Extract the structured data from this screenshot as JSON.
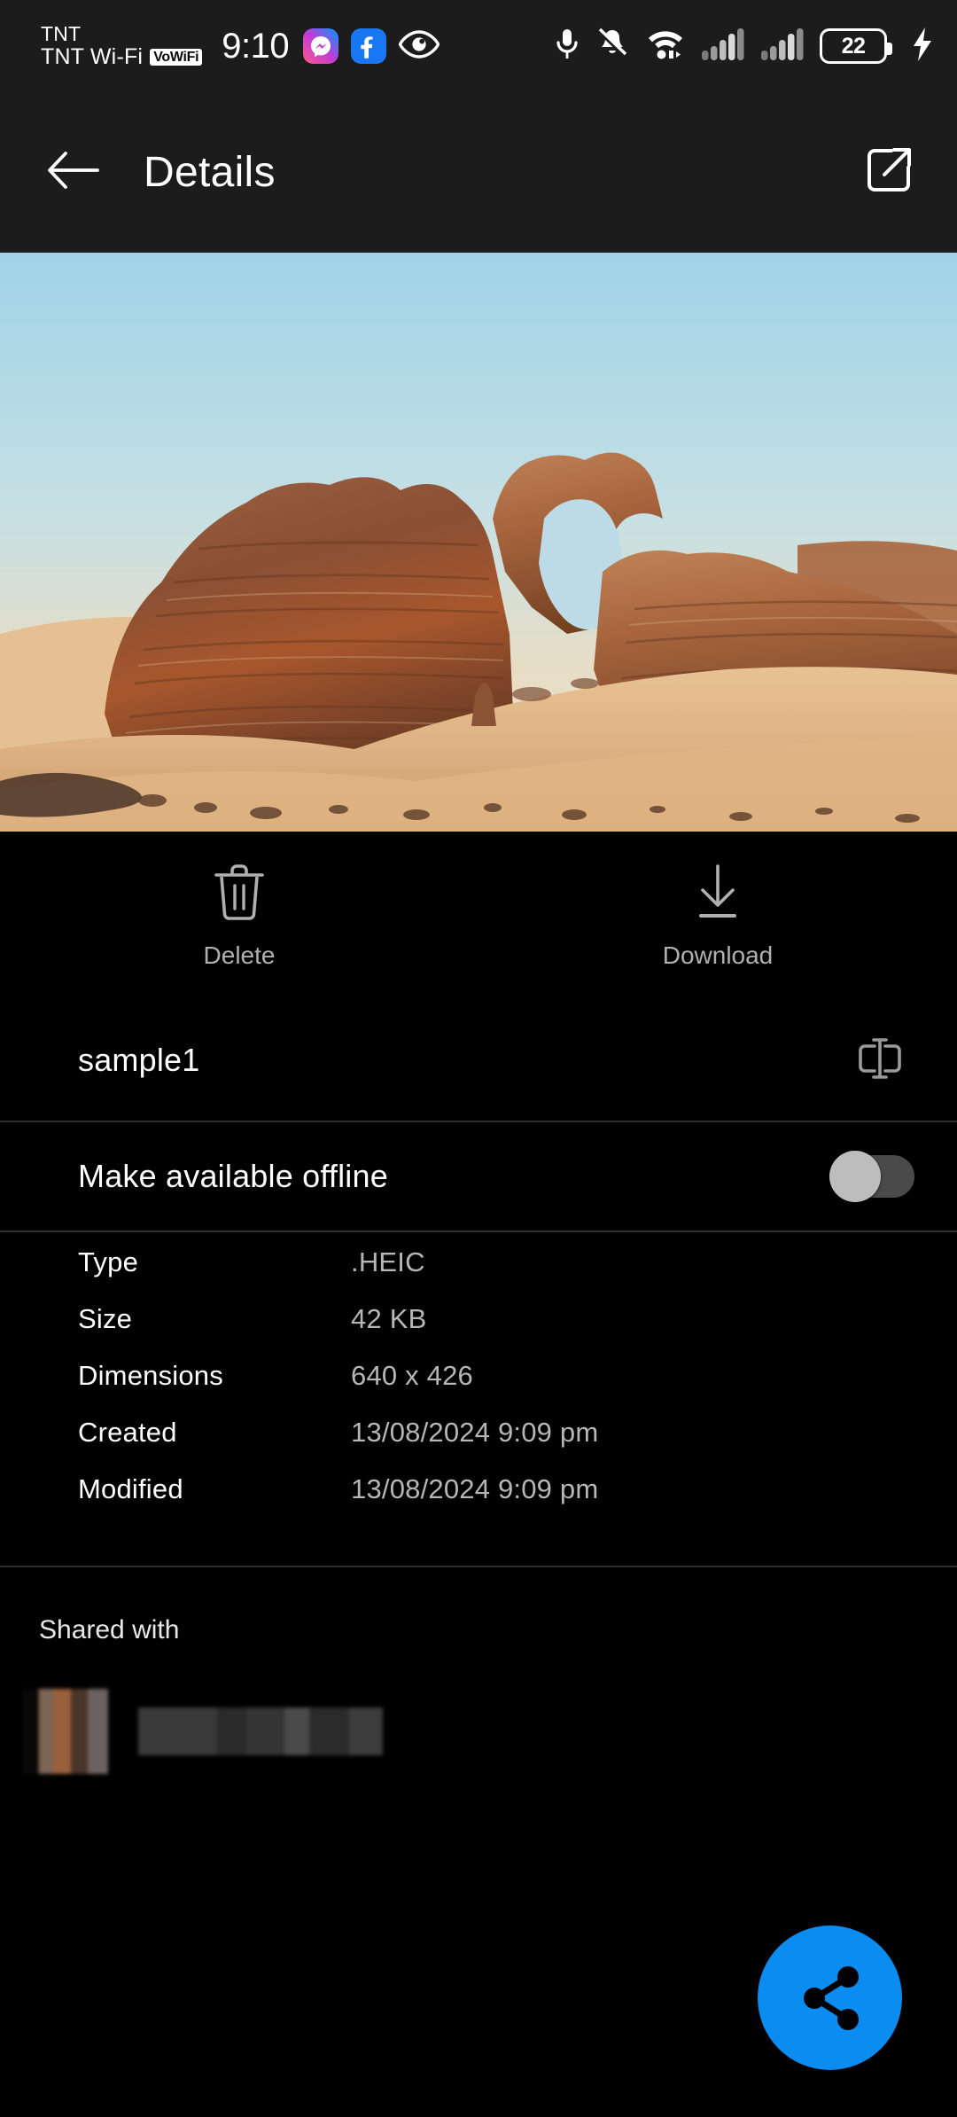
{
  "status_bar": {
    "carrier_line1": "TNT",
    "carrier_line2": "TNT Wi-Fi",
    "vowifi_badge": "VoWiFi",
    "clock": "9:10",
    "app_icons": [
      "messenger-icon",
      "facebook-icon",
      "eye-icon"
    ],
    "right_icons": [
      "microphone-icon",
      "notifications-off-icon",
      "wifi-calling-icon",
      "signal-sim1-icon",
      "signal-sim2-icon"
    ],
    "battery_level": "22",
    "battery_charging": true,
    "charging_icon": "lightning-bolt-icon"
  },
  "header": {
    "back_icon": "arrow-left-icon",
    "title": "Details",
    "open_in_icon": "open-external-icon"
  },
  "photo": {
    "alt": "desert rock arch with sand dune",
    "sky_top_color": "#a8d5e8",
    "sky_bottom_color": "#efe0c0",
    "rock_color": "#8a4a2c",
    "sand_color": "#e0b582"
  },
  "actions": [
    {
      "label": "Delete",
      "icon": "trash-icon"
    },
    {
      "label": "Download",
      "icon": "download-arrow-icon"
    }
  ],
  "file": {
    "name": "sample1",
    "rename_icon": "text-cursor-rename-icon"
  },
  "offline": {
    "label": "Make available offline",
    "enabled": false
  },
  "metadata": [
    {
      "key": "Type",
      "value": ".HEIC"
    },
    {
      "key": "Size",
      "value": "42 KB"
    },
    {
      "key": "Dimensions",
      "value": "640 x 426"
    },
    {
      "key": "Created",
      "value": "13/08/2024 9:09 pm"
    },
    {
      "key": "Modified",
      "value": "13/08/2024 9:09 pm"
    }
  ],
  "shared": {
    "title": "Shared with",
    "people": [
      {
        "avatar": "blurred-avatar",
        "name": ""
      }
    ]
  },
  "fab": {
    "icon": "share-icon",
    "color": "#0a8cf0"
  },
  "colors": {
    "background": "#000000",
    "chrome": "#1c1c1c",
    "divider": "#2e2e2e",
    "primary_text": "#ffffff",
    "secondary_text": "#b6b6b6",
    "accent": "#0a8cf0"
  }
}
